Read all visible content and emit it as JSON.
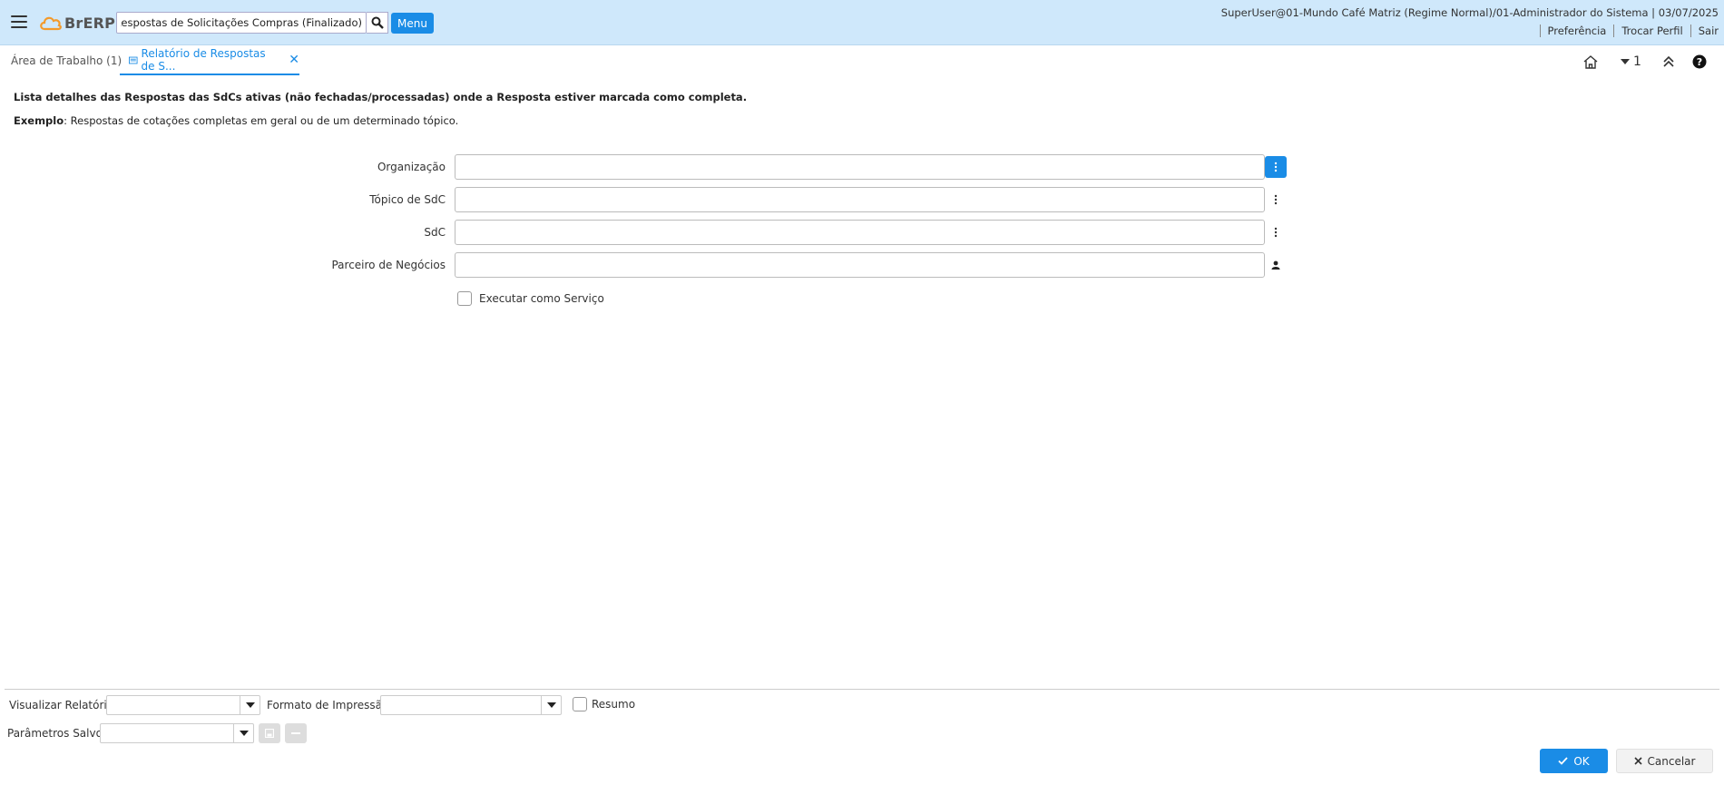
{
  "header": {
    "logo_text": "BrERP",
    "search_value": "Relatório de Respostas de Solicitações Compras (Finalizado)",
    "menu_label": "Menu",
    "user_info": "SuperUser@01-Mundo Café Matriz (Regime Normal)/01-Administrador do Sistema | 03/07/2025",
    "links": [
      "Preferência",
      "Trocar Perfil",
      "Sair"
    ]
  },
  "tabs": {
    "work": "Área de Trabalho (1)",
    "report": "Relatório de Respostas de S..."
  },
  "toolbar": {
    "nav_count": "1"
  },
  "description": {
    "text": "Lista detalhes das Respostas das SdCs ativas (não fechadas/processadas) onde a Resposta estiver marcada como completa.",
    "example_label": "Exemplo",
    "example_text": ": Respostas de cotações completas em geral ou de um determinado tópico."
  },
  "form": {
    "fields": [
      {
        "label": "Organização",
        "value": ""
      },
      {
        "label": "Tópico de SdC",
        "value": ""
      },
      {
        "label": "SdC",
        "value": ""
      },
      {
        "label": "Parceiro de Negócios",
        "value": ""
      }
    ],
    "run_as_service": "Executar como Serviço"
  },
  "footer": {
    "view_report": "Visualizar Relatório",
    "print_format": "Formato de Impressão",
    "summary": "Resumo",
    "saved_params": "Parâmetros Salvos",
    "ok": "OK",
    "cancel": "Cancelar"
  },
  "colors": {
    "accent": "#1a8ce6",
    "header_bg": "#cfe8fb",
    "logo_orange": "#f39a2b"
  }
}
